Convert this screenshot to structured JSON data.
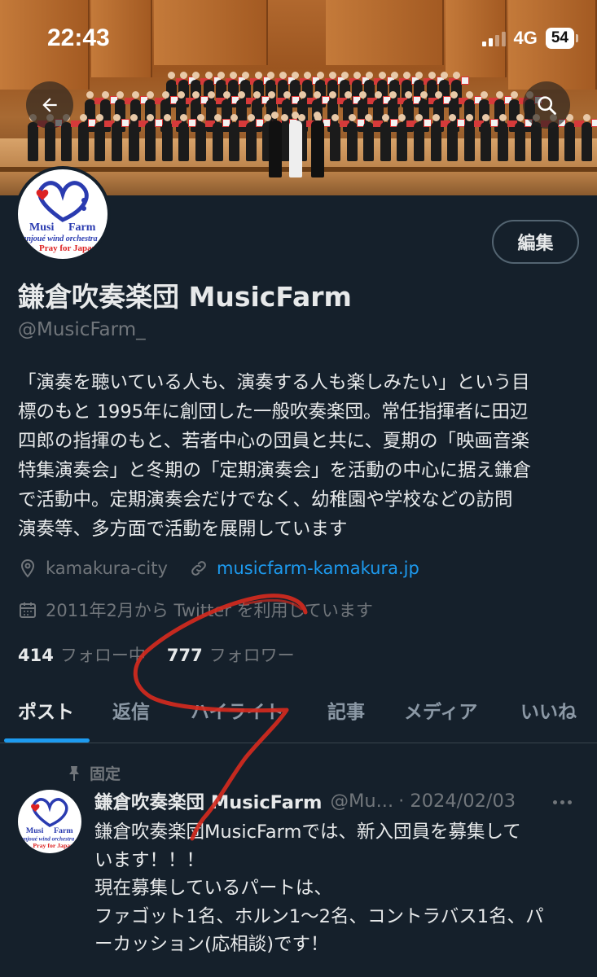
{
  "status_bar": {
    "time": "22:43",
    "network": "4G",
    "battery": "54"
  },
  "banner": {
    "back_icon": "back-arrow-icon",
    "search_icon": "search-icon"
  },
  "avatar": {
    "logo_text_1": "Musi",
    "logo_text_2": "Farm",
    "logo_text_3": "enjoué wind orchestra",
    "logo_text_4": "Pray for Japan"
  },
  "profile": {
    "edit_label": "編集",
    "display_name": "鎌倉吹奏楽団 MusicFarm",
    "handle": "@MusicFarm_",
    "bio_lines": [
      "「演奏を聴いている人も、演奏する人も楽しみたい」という目",
      "標のもと 1995年に創団した一般吹奏楽団。常任指揮者に田辺",
      "四郎の指揮のもと、若者中心の団員と共に、夏期の「映画音楽",
      "特集演奏会」と冬期の「定期演奏会」を活動の中心に据え鎌倉",
      "で活動中。定期演奏会だけでなく、幼稚園や学校などの訪問",
      "演奏等、多方面で活動を展開しています"
    ],
    "location": "kamakura-city",
    "website": "musicfarm-kamakura.jp",
    "joined": "2011年2月から Twitter を利用しています",
    "following_count": "414",
    "following_label": "フォロー中",
    "followers_count": "777",
    "followers_label": "フォロワー"
  },
  "tabs": [
    {
      "label": "ポスト",
      "active": true
    },
    {
      "label": "返信",
      "active": false
    },
    {
      "label": "ハイライト",
      "active": false
    },
    {
      "label": "記事",
      "active": false
    },
    {
      "label": "メディア",
      "active": false
    },
    {
      "label": "いいね",
      "active": false
    }
  ],
  "post": {
    "pinned_label": "固定",
    "author_name": "鎌倉吹奏楽団 MusicFarm",
    "author_handle": "@Mu...",
    "date": "· 2024/02/03",
    "body_lines": [
      "鎌倉吹奏楽団MusicFarmでは、新入団員を募集して",
      "います！！！",
      "現在募集しているパートは、",
      "ファゴット1名、ホルン1〜2名、コントラバス1名、パ",
      "ーカッション(応相談)です！"
    ]
  },
  "colors": {
    "background": "#15202b",
    "accent": "#1d9bf0",
    "muted": "#71767b",
    "annotation": "#d42a1e"
  }
}
